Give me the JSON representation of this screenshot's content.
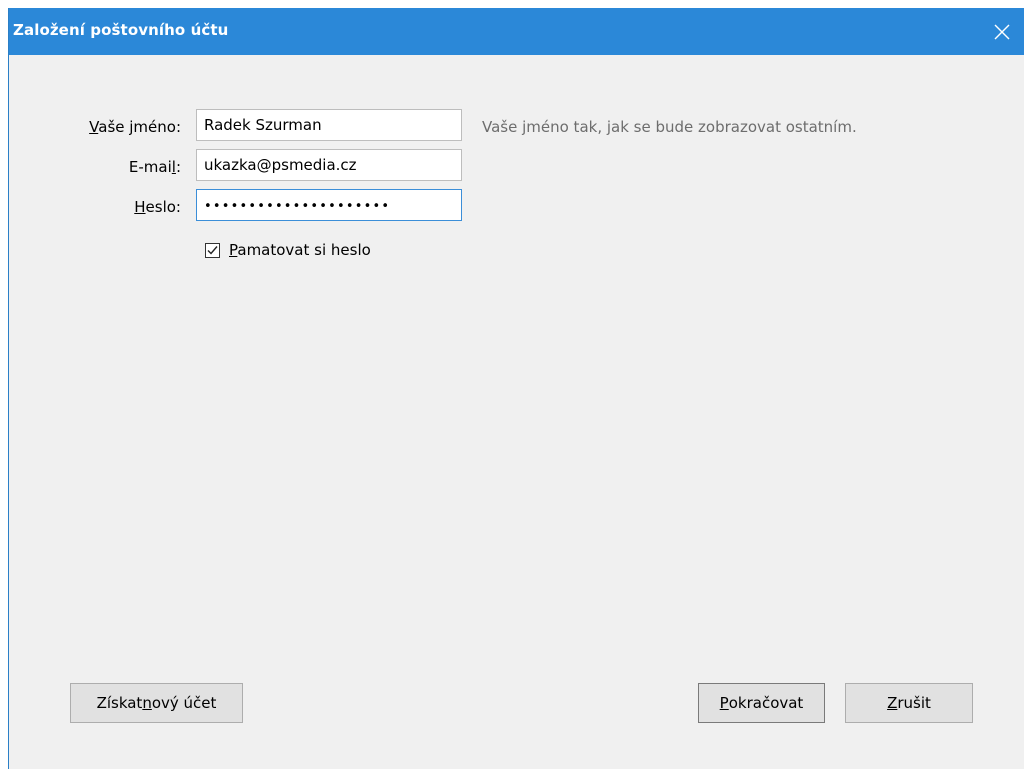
{
  "window": {
    "title": "Založení poštovního účtu",
    "close_icon": "close-icon"
  },
  "form": {
    "name": {
      "label_mnemonic": "V",
      "label_rest": "aše jméno:",
      "value": "Radek Szurman",
      "hint": "Vaše jméno tak, jak se bude zobrazovat ostatním."
    },
    "email": {
      "label_before": "E-mai",
      "label_mnemonic": "l",
      "label_after": ":",
      "value": "ukazka@psmedia.cz"
    },
    "password": {
      "label_mnemonic": "H",
      "label_rest": "eslo:",
      "masked_value": "•••••••••••••••••••••"
    },
    "remember": {
      "checked": true,
      "label_mnemonic": "P",
      "label_rest": "amatovat si heslo"
    }
  },
  "buttons": {
    "new_account": {
      "before": "Získat ",
      "mnemonic": "n",
      "after": "ový účet"
    },
    "continue": {
      "mnemonic": "P",
      "rest": "okračovat"
    },
    "cancel": {
      "mnemonic": "Z",
      "rest": "rušit"
    }
  },
  "colors": {
    "titlebar": "#2b88d8",
    "window_bg": "#f0f0f0",
    "focus_border": "#3b8ed8"
  }
}
